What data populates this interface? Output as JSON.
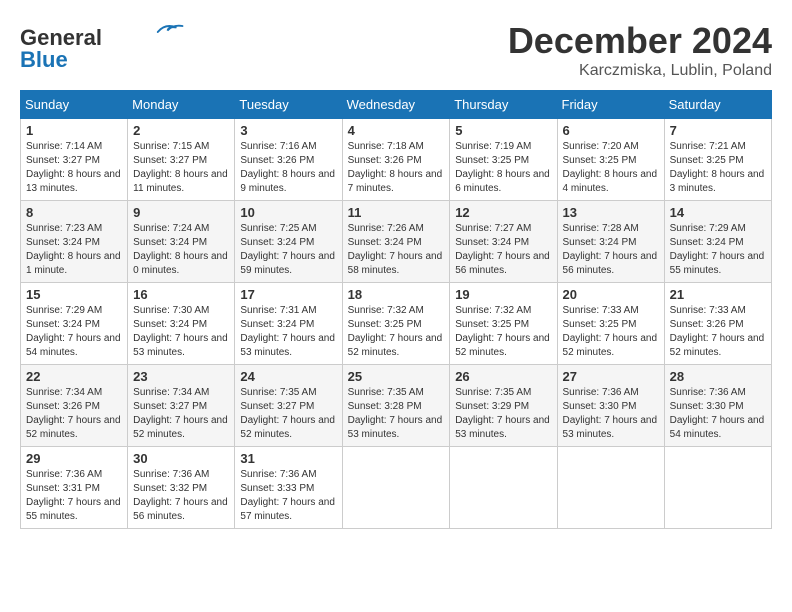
{
  "header": {
    "logo_line1": "General",
    "logo_line2": "Blue",
    "month_title": "December 2024",
    "location": "Karczmiska, Lublin, Poland"
  },
  "days_of_week": [
    "Sunday",
    "Monday",
    "Tuesday",
    "Wednesday",
    "Thursday",
    "Friday",
    "Saturday"
  ],
  "weeks": [
    [
      {
        "day": 1,
        "sunrise": "7:14 AM",
        "sunset": "3:27 PM",
        "daylight": "8 hours and 13 minutes."
      },
      {
        "day": 2,
        "sunrise": "7:15 AM",
        "sunset": "3:27 PM",
        "daylight": "8 hours and 11 minutes."
      },
      {
        "day": 3,
        "sunrise": "7:16 AM",
        "sunset": "3:26 PM",
        "daylight": "8 hours and 9 minutes."
      },
      {
        "day": 4,
        "sunrise": "7:18 AM",
        "sunset": "3:26 PM",
        "daylight": "8 hours and 7 minutes."
      },
      {
        "day": 5,
        "sunrise": "7:19 AM",
        "sunset": "3:25 PM",
        "daylight": "8 hours and 6 minutes."
      },
      {
        "day": 6,
        "sunrise": "7:20 AM",
        "sunset": "3:25 PM",
        "daylight": "8 hours and 4 minutes."
      },
      {
        "day": 7,
        "sunrise": "7:21 AM",
        "sunset": "3:25 PM",
        "daylight": "8 hours and 3 minutes."
      }
    ],
    [
      {
        "day": 8,
        "sunrise": "7:23 AM",
        "sunset": "3:24 PM",
        "daylight": "8 hours and 1 minute."
      },
      {
        "day": 9,
        "sunrise": "7:24 AM",
        "sunset": "3:24 PM",
        "daylight": "8 hours and 0 minutes."
      },
      {
        "day": 10,
        "sunrise": "7:25 AM",
        "sunset": "3:24 PM",
        "daylight": "7 hours and 59 minutes."
      },
      {
        "day": 11,
        "sunrise": "7:26 AM",
        "sunset": "3:24 PM",
        "daylight": "7 hours and 58 minutes."
      },
      {
        "day": 12,
        "sunrise": "7:27 AM",
        "sunset": "3:24 PM",
        "daylight": "7 hours and 56 minutes."
      },
      {
        "day": 13,
        "sunrise": "7:28 AM",
        "sunset": "3:24 PM",
        "daylight": "7 hours and 56 minutes."
      },
      {
        "day": 14,
        "sunrise": "7:29 AM",
        "sunset": "3:24 PM",
        "daylight": "7 hours and 55 minutes."
      }
    ],
    [
      {
        "day": 15,
        "sunrise": "7:29 AM",
        "sunset": "3:24 PM",
        "daylight": "7 hours and 54 minutes."
      },
      {
        "day": 16,
        "sunrise": "7:30 AM",
        "sunset": "3:24 PM",
        "daylight": "7 hours and 53 minutes."
      },
      {
        "day": 17,
        "sunrise": "7:31 AM",
        "sunset": "3:24 PM",
        "daylight": "7 hours and 53 minutes."
      },
      {
        "day": 18,
        "sunrise": "7:32 AM",
        "sunset": "3:25 PM",
        "daylight": "7 hours and 52 minutes."
      },
      {
        "day": 19,
        "sunrise": "7:32 AM",
        "sunset": "3:25 PM",
        "daylight": "7 hours and 52 minutes."
      },
      {
        "day": 20,
        "sunrise": "7:33 AM",
        "sunset": "3:25 PM",
        "daylight": "7 hours and 52 minutes."
      },
      {
        "day": 21,
        "sunrise": "7:33 AM",
        "sunset": "3:26 PM",
        "daylight": "7 hours and 52 minutes."
      }
    ],
    [
      {
        "day": 22,
        "sunrise": "7:34 AM",
        "sunset": "3:26 PM",
        "daylight": "7 hours and 52 minutes."
      },
      {
        "day": 23,
        "sunrise": "7:34 AM",
        "sunset": "3:27 PM",
        "daylight": "7 hours and 52 minutes."
      },
      {
        "day": 24,
        "sunrise": "7:35 AM",
        "sunset": "3:27 PM",
        "daylight": "7 hours and 52 minutes."
      },
      {
        "day": 25,
        "sunrise": "7:35 AM",
        "sunset": "3:28 PM",
        "daylight": "7 hours and 53 minutes."
      },
      {
        "day": 26,
        "sunrise": "7:35 AM",
        "sunset": "3:29 PM",
        "daylight": "7 hours and 53 minutes."
      },
      {
        "day": 27,
        "sunrise": "7:36 AM",
        "sunset": "3:30 PM",
        "daylight": "7 hours and 53 minutes."
      },
      {
        "day": 28,
        "sunrise": "7:36 AM",
        "sunset": "3:30 PM",
        "daylight": "7 hours and 54 minutes."
      }
    ],
    [
      {
        "day": 29,
        "sunrise": "7:36 AM",
        "sunset": "3:31 PM",
        "daylight": "7 hours and 55 minutes."
      },
      {
        "day": 30,
        "sunrise": "7:36 AM",
        "sunset": "3:32 PM",
        "daylight": "7 hours and 56 minutes."
      },
      {
        "day": 31,
        "sunrise": "7:36 AM",
        "sunset": "3:33 PM",
        "daylight": "7 hours and 57 minutes."
      },
      null,
      null,
      null,
      null
    ]
  ]
}
